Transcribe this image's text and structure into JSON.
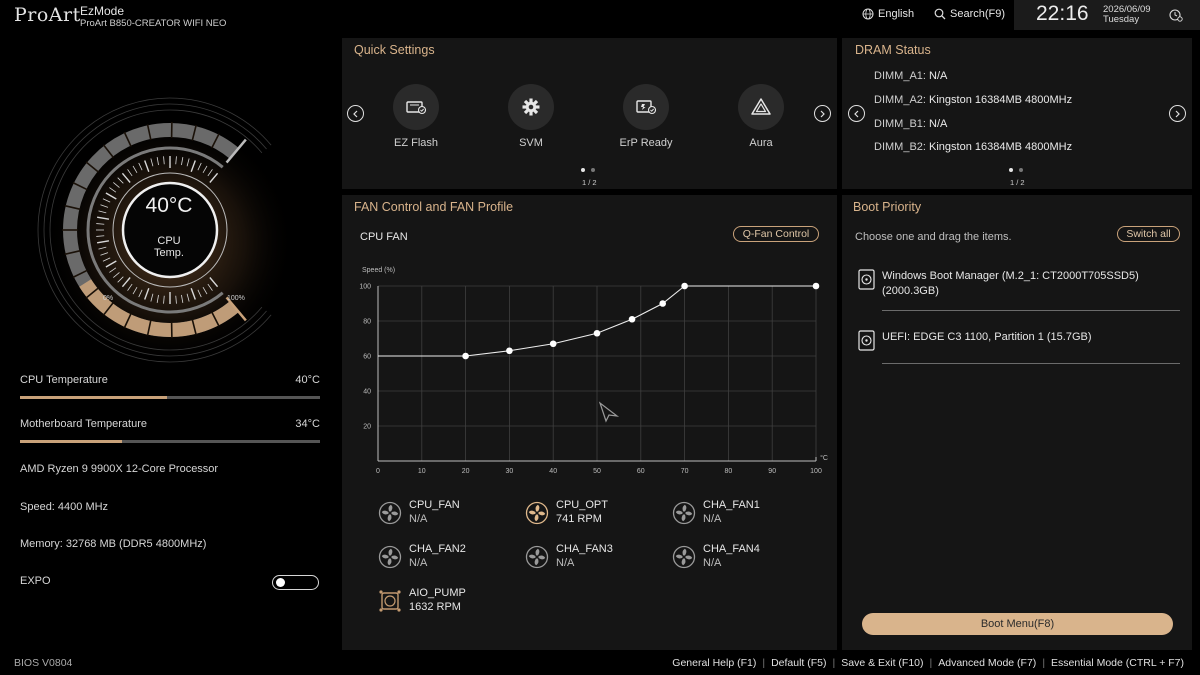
{
  "header": {
    "logo": "ProArt",
    "mode": "EzMode",
    "board": "ProArt B850-CREATOR WIFI NEO",
    "language": "English",
    "search": "Search(F9)",
    "time": "22:16",
    "date": "2026/06/09",
    "weekday": "Tuesday",
    "icons": {
      "language": "globe-icon",
      "search": "magnifier-icon",
      "clock": "clock-settings-icon"
    }
  },
  "gauge": {
    "temperature": "40°C",
    "label_line1": "CPU",
    "label_line2": "Temp.",
    "min_label": "0%",
    "max_label": "100%",
    "accent": "#c9a27a"
  },
  "system": {
    "cpu_temp_label": "CPU Temperature",
    "cpu_temp_value": "40°C",
    "cpu_temp_level": 0.49,
    "mb_temp_label": "Motherboard Temperature",
    "mb_temp_value": "34°C",
    "mb_temp_level": 0.34,
    "processor": "AMD Ryzen 9 9900X 12-Core Processor",
    "speed": "Speed: 4400 MHz",
    "memory": "Memory: 32768 MB (DDR5 4800MHz)",
    "expo_label": "EXPO",
    "expo_on": false
  },
  "quick_settings": {
    "title": "Quick Settings",
    "items": [
      {
        "label": "EZ Flash",
        "icon": "flash-chip-icon"
      },
      {
        "label": "SVM",
        "icon": "gear-icon"
      },
      {
        "label": "ErP Ready",
        "icon": "erp-plug-icon"
      },
      {
        "label": "Aura",
        "icon": "aura-icon"
      }
    ],
    "page": "1 / 2"
  },
  "dram": {
    "title": "DRAM Status",
    "slots": [
      {
        "name": "DIMM_A1:",
        "value": "N/A"
      },
      {
        "name": "DIMM_A2:",
        "value": "Kingston 16384MB 4800MHz"
      },
      {
        "name": "DIMM_B1:",
        "value": "N/A"
      },
      {
        "name": "DIMM_B2:",
        "value": "Kingston 16384MB 4800MHz"
      }
    ],
    "page": "1 / 2"
  },
  "fan": {
    "title": "FAN Control and FAN Profile",
    "selected": "CPU FAN",
    "qfan_button": "Q-Fan Control",
    "fans": [
      {
        "name": "CPU_FAN",
        "rpm": "N/A",
        "active": false
      },
      {
        "name": "CPU_OPT",
        "rpm": "741 RPM",
        "active": true
      },
      {
        "name": "CHA_FAN1",
        "rpm": "N/A",
        "active": false
      },
      {
        "name": "CHA_FAN2",
        "rpm": "N/A",
        "active": false
      },
      {
        "name": "CHA_FAN3",
        "rpm": "N/A",
        "active": false
      },
      {
        "name": "CHA_FAN4",
        "rpm": "N/A",
        "active": false
      },
      {
        "name": "AIO_PUMP",
        "rpm": "1632 RPM",
        "active": false,
        "icon": "pump-icon"
      }
    ]
  },
  "chart_data": {
    "type": "line",
    "title": "",
    "ylabel": "Speed (%)",
    "xlabel": "°C",
    "xlim": [
      0,
      100
    ],
    "ylim": [
      0,
      100
    ],
    "xticks": [
      "0",
      "10",
      "20",
      "30",
      "40",
      "50",
      "60",
      "70",
      "80",
      "90",
      "100"
    ],
    "yticks": [
      "20",
      "40",
      "60",
      "80",
      "100"
    ],
    "grid": true,
    "series": [
      {
        "points": [
          [
            20,
            60
          ],
          [
            30,
            63
          ],
          [
            40,
            67
          ],
          [
            50,
            73
          ],
          [
            58,
            81
          ],
          [
            65,
            90
          ],
          [
            70,
            100
          ],
          [
            100,
            100
          ]
        ],
        "lead_in_from": [
          0,
          60
        ]
      }
    ]
  },
  "boot": {
    "title": "Boot Priority",
    "subtitle": "Choose one and drag the items.",
    "switch_all": "Switch all",
    "items": [
      {
        "line1": "Windows Boot Manager (M.2_1: CT2000T705SSD5)",
        "line2": "(2000.3GB)"
      },
      {
        "line1": "UEFI: EDGE C3 1100, Partition 1 (15.7GB)",
        "line2": ""
      }
    ],
    "boot_menu": "Boot Menu(F8)"
  },
  "footer": {
    "bios": "BIOS V0804",
    "keys": [
      "General Help (F1)",
      "Default (F5)",
      "Save & Exit (F10)",
      "Advanced Mode (F7)",
      "Essential Mode (CTRL + F7)"
    ]
  }
}
